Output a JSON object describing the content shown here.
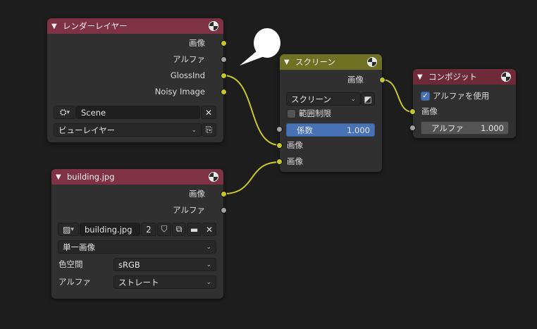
{
  "render_layer_node": {
    "title": "レンダーレイヤー",
    "outputs": [
      "画像",
      "アルファ",
      "GlossInd",
      "Noisy Image"
    ],
    "scene": "Scene",
    "view_layer": "ビューレイヤー"
  },
  "screen_node": {
    "title": "スクリーン",
    "output": "画像",
    "blend_mode": "スクリーン",
    "clamp_label": "範囲制限",
    "factor_label": "係数",
    "factor_value": "1.000",
    "input1": "画像",
    "input2": "画像"
  },
  "composite_node": {
    "title": "コンポジット",
    "use_alpha_label": "アルファを使用",
    "input_image": "画像",
    "alpha_label": "アルファ",
    "alpha_value": "1.000"
  },
  "image_node": {
    "title": "building.jpg",
    "outputs": [
      "画像",
      "アルファ"
    ],
    "image_name": "building.jpg",
    "users": "2",
    "source": "単一画像",
    "color_space_label": "色空間",
    "color_space": "sRGB",
    "alpha_label": "アルファ",
    "alpha_mode": "ストレート"
  },
  "colors": {
    "socket_color": "#c7c729",
    "socket_alpha": "#a1a1a1",
    "link": "#c7c729",
    "factor_field": "#4772b3"
  }
}
